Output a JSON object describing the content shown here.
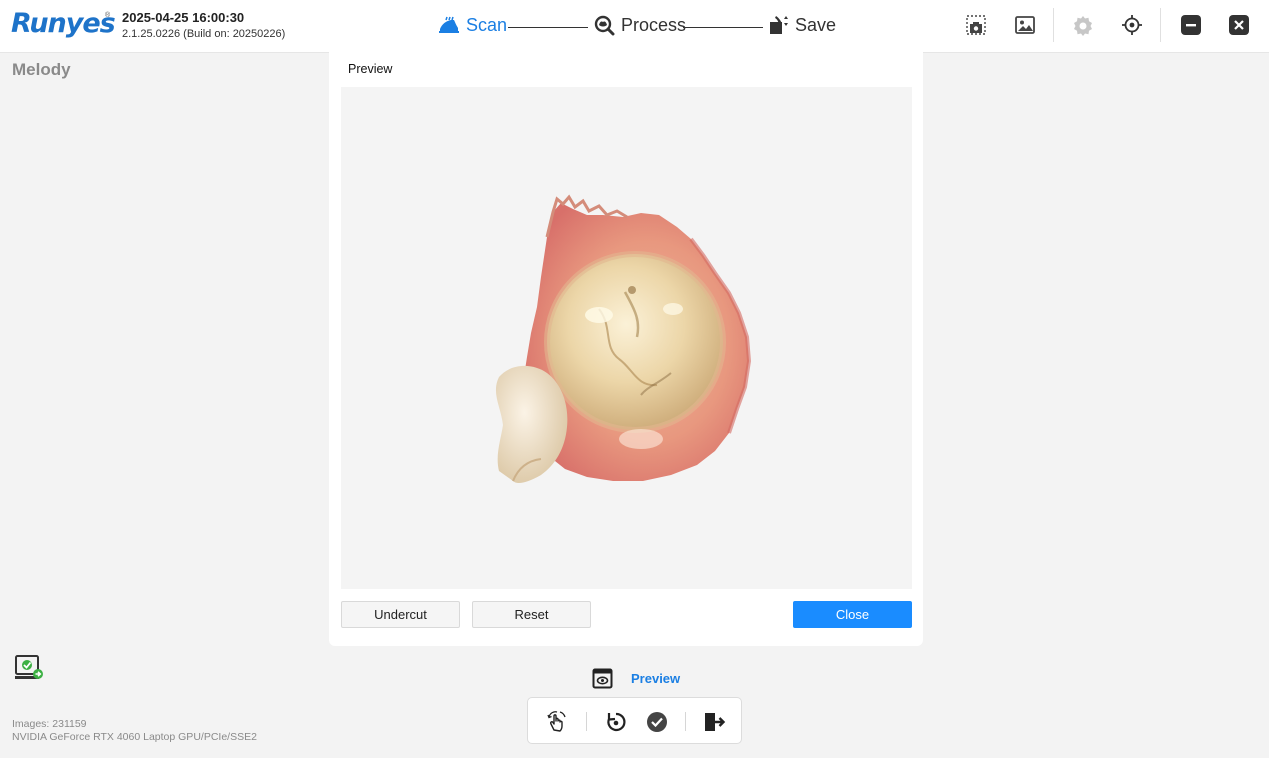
{
  "header": {
    "logo": "Runyes",
    "logo_mark": "®",
    "datetime": "2025-04-25 16:00:30",
    "build": "2.1.25.0226 (Build on: 20250226)",
    "steps": [
      {
        "label": "Scan",
        "icon": "scan-icon",
        "active": true
      },
      {
        "label": "Process",
        "icon": "process-icon",
        "active": false
      },
      {
        "label": "Save",
        "icon": "save-icon",
        "active": false
      }
    ],
    "tools": [
      "capture-icon",
      "gallery-icon",
      "settings-icon",
      "calibrate-icon",
      "minimize-icon",
      "close-icon"
    ]
  },
  "sidebar": {
    "patient_name": "Melody",
    "images_count": "Images: 231159",
    "gpu_info": "NVIDIA GeForce RTX 4060 Laptop GPU/PCIe/SSE2"
  },
  "dialog": {
    "title": "Preview",
    "buttons": {
      "undercut": "Undercut",
      "reset": "Reset",
      "close": "Close"
    }
  },
  "bottom": {
    "preview_label": "Preview",
    "toolbar": [
      "gesture-icon",
      "rotate-icon",
      "confirm-icon",
      "exit-icon"
    ]
  },
  "colors": {
    "accent": "#1b7fe3",
    "primary_button": "#1a8cff",
    "logo": "#1e73c9"
  }
}
